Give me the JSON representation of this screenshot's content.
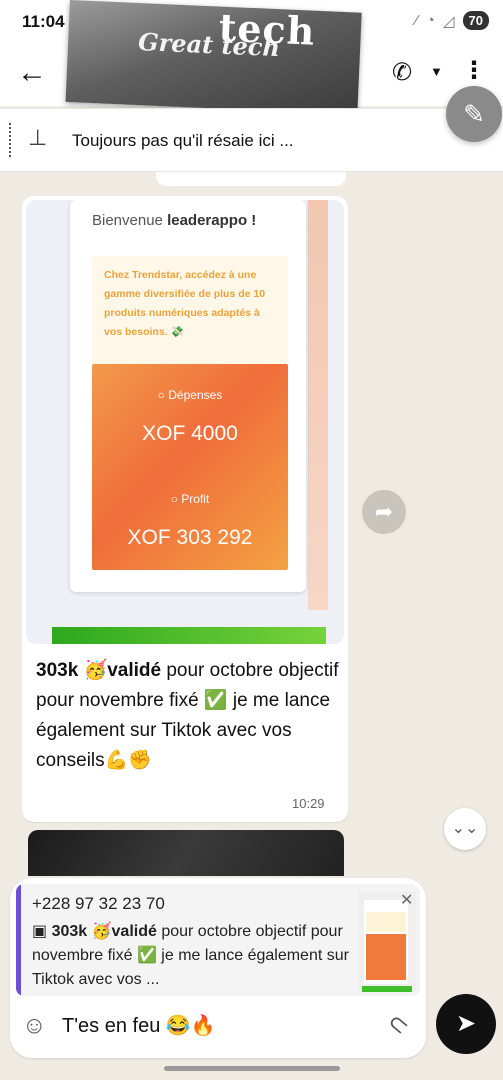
{
  "status_bar": {
    "time": "11:04",
    "battery": "70"
  },
  "header": {
    "banner_line1": "tech",
    "banner_line2": "Great tech"
  },
  "pinned": {
    "text": "Toujours pas qu'il résaie ici ..."
  },
  "message": {
    "screenshot": {
      "welcome_prefix": "Bienvenue",
      "welcome_user": "leaderappo !",
      "promo_text": "Chez Trendstar, accédez à une gamme diversifiée de plus de 10 produits numériques adaptés à vos besoins. 💸",
      "spend_label": "Dépenses",
      "spend_value": "XOF 4000",
      "profit_label": "Profit",
      "profit_value": "XOF 303 292"
    },
    "caption_bold1": "303k 🥳validé",
    "caption_rest": " pour octobre objectif pour novembre fixé ✅ je me lance également sur Tiktok avec vos conseils💪✊",
    "time": "10:29"
  },
  "reply_preview": {
    "sender": "+228 97 32 23 70",
    "bold": "303k 🥳validé",
    "text": " pour octobre objectif pour novembre fixé ✅ je me lance également sur Tiktok avec vos ..."
  },
  "composer": {
    "value": "T'es en feu 😂🔥"
  },
  "icons": {
    "back": "arrow-left",
    "call": "phone",
    "menu": "kebab",
    "pin": "pin",
    "edit": "pencil",
    "forward": "forward",
    "scroll": "double-chevron-down",
    "emoji": "sticker",
    "attach": "paperclip",
    "send": "send"
  }
}
